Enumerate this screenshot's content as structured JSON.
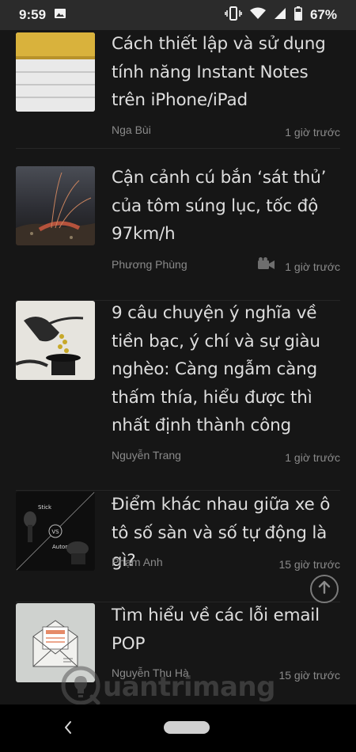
{
  "status_bar": {
    "time": "9:59",
    "battery": "67%"
  },
  "articles": [
    {
      "title": "Cách thiết lập và sử dụng tính năng Instant Notes trên iPhone/iPad",
      "author": "Nga Bùi",
      "time": "1 giờ trước",
      "thumb_icon": "notes-app-icon"
    },
    {
      "title": "Cận cảnh cú bắn ‘sát thủ’ của tôm súng lục, tốc độ 97km/h",
      "author": "Phương Phùng",
      "time": "1 giờ trước",
      "has_video": true,
      "thumb_icon": "shrimp-photo"
    },
    {
      "title": "9 câu chuyện ý nghĩa về tiền bạc, ý chí và sự giàu nghèo: Càng ngẫm càng thấm thía, hiểu được thì nhất định thành công",
      "author": "Nguyễn Trang",
      "time": "1 giờ trước",
      "thumb_icon": "money-hat-illustration"
    },
    {
      "title": "Điểm khác nhau giữa xe ô tô số sàn và số tự động là gì?",
      "author": "Phạm Anh",
      "time": "15 giờ trước",
      "thumb_icon": "gear-shift-comparison",
      "thumb_labels": {
        "left": "Stick",
        "middle": "VS",
        "right": "Automatic"
      }
    },
    {
      "title": "Tìm hiểu về các lỗi email POP",
      "author": "Nguyễn Thu Hà",
      "time": "15 giờ trước",
      "thumb_icon": "email-envelope-icon"
    }
  ],
  "watermark": {
    "text": "uantrimang"
  },
  "icons": {
    "status_left": [
      "image-icon"
    ],
    "status_right": [
      "vibrate-icon",
      "wifi-icon",
      "signal-icon",
      "battery-icon"
    ],
    "scroll_top": "arrow-up-circle-icon",
    "nav": [
      "back-icon",
      "home-pill"
    ]
  }
}
